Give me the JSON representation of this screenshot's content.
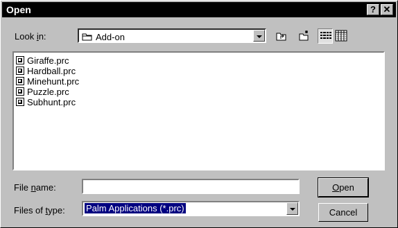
{
  "window": {
    "title": "Open",
    "help_glyph": "?",
    "close_glyph": "✕"
  },
  "look_in": {
    "label_pre": "Look ",
    "label_key": "i",
    "label_post": "n:",
    "value": "Add-on"
  },
  "toolbar": {
    "icons": [
      "up-one-level-icon",
      "create-new-folder-icon",
      "list-view-icon",
      "details-view-icon"
    ]
  },
  "files": [
    "Giraffe.prc",
    "Hardball.prc",
    "Minehunt.prc",
    "Puzzle.prc",
    "Subhunt.prc"
  ],
  "file_name": {
    "label_pre": "File ",
    "label_key": "n",
    "label_post": "ame:",
    "value": ""
  },
  "files_of_type": {
    "label_pre": "Files of ",
    "label_key": "t",
    "label_post": "ype:",
    "value": "Palm Applications (*.prc)"
  },
  "buttons": {
    "open_key": "O",
    "open_rest": "pen",
    "cancel": "Cancel"
  },
  "colors": {
    "selection": "#000080",
    "face": "#c0c0c0"
  }
}
